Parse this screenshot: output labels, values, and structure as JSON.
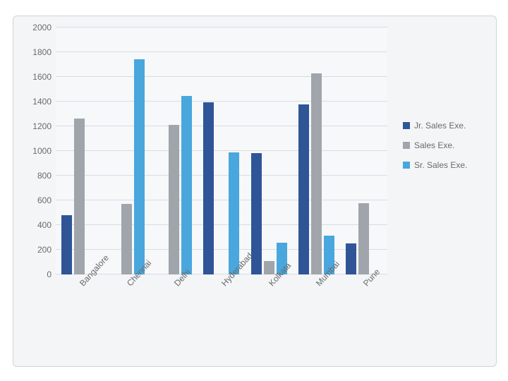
{
  "chart_data": {
    "type": "bar",
    "title": "",
    "xlabel": "",
    "ylabel": "",
    "ylim": [
      0,
      2000
    ],
    "y_ticks": [
      0,
      200,
      400,
      600,
      800,
      1000,
      1200,
      1400,
      1600,
      1800,
      2000
    ],
    "categories": [
      "Bangalore",
      "Chennai",
      "Delhi",
      "Hyderabad",
      "Kolkata",
      "Mumbai",
      "Pune"
    ],
    "series": [
      {
        "name": "Jr. Sales Exe.",
        "color": "#2f5597",
        "values": [
          480,
          0,
          0,
          1395,
          985,
          1380,
          250
        ]
      },
      {
        "name": "Sales Exe.",
        "color": "#9fa5ab",
        "values": [
          1265,
          570,
          1210,
          0,
          110,
          1630,
          580
        ]
      },
      {
        "name": "Sr. Sales Exe.",
        "color": "#49a7dd",
        "values": [
          0,
          1745,
          1445,
          988,
          260,
          315,
          0
        ]
      }
    ],
    "legend_position": "right",
    "grid": true
  }
}
